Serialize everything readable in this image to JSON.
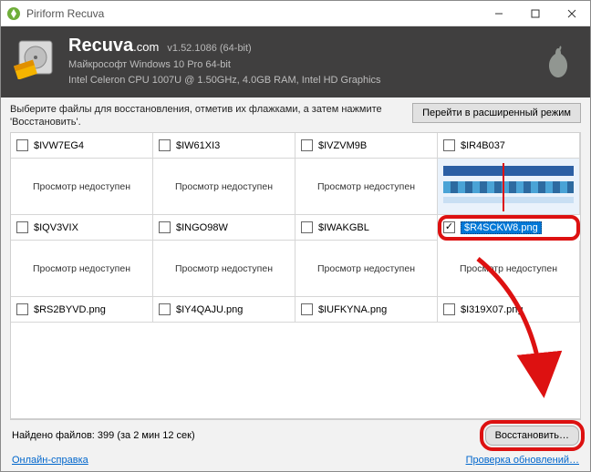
{
  "titlebar": {
    "title": "Piriform Recuva"
  },
  "header": {
    "brand": "Recuva",
    "brand_suffix": ".com",
    "version": "v1.52.1086 (64-bit)",
    "sys1": "Майкрософт Windows 10 Pro 64-bit",
    "sys2": "Intel Celeron CPU 1007U @ 1.50GHz, 4.0GB RAM, Intel HD Graphics"
  },
  "instructions": "Выберите файлы для восстановления, отметив их флажками, а затем нажмите 'Восстановить'.",
  "advanced_button": "Перейти в расширенный режим",
  "preview_na": "Просмотр недоступен",
  "files": {
    "r0": [
      "$IVW7EG4",
      "$IW61XI3",
      "$IVZVM9B",
      "$IR4B037"
    ],
    "r1": [
      "$IQV3VIX",
      "$INGO98W",
      "$IWAKGBL",
      "$R4SCKW8.png"
    ],
    "r2": [
      "$RS2BYVD.png",
      "$IY4QAJU.png",
      "$IUFKYNA.png",
      "$I319X07.png"
    ]
  },
  "status": "Найдено файлов: 399 (за 2 мин 12 сек)",
  "recover_button": "Восстановить…",
  "links": {
    "help": "Онлайн-справка",
    "updates": "Проверка обновлений…"
  }
}
